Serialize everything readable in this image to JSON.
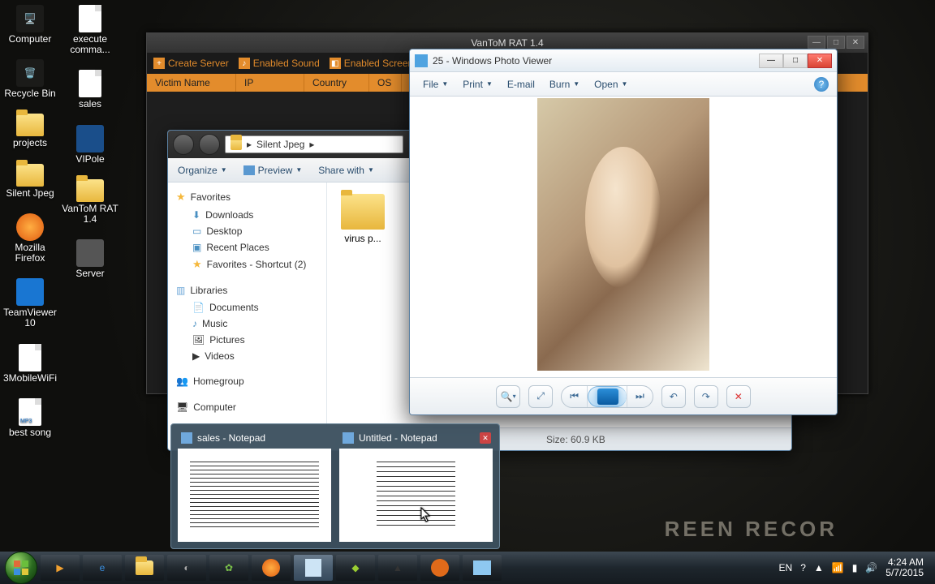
{
  "desktop": {
    "col1": [
      {
        "label": "Computer",
        "type": "monitor"
      },
      {
        "label": "Recycle Bin",
        "type": "bin"
      },
      {
        "label": "projects",
        "type": "folder"
      },
      {
        "label": "Silent Jpeg",
        "type": "folder"
      },
      {
        "label": "Mozilla Firefox",
        "type": "firefox"
      },
      {
        "label": "TeamViewer 10",
        "type": "tv"
      },
      {
        "label": "3MobileWiFi",
        "type": "3g"
      },
      {
        "label": "best song",
        "type": "mp3"
      }
    ],
    "col2": [
      {
        "label": "execute comma...",
        "type": "file"
      },
      {
        "label": "sales",
        "type": "file"
      },
      {
        "label": "VIPole",
        "type": "vip"
      },
      {
        "label": "VanToM RAT 1.4",
        "type": "folder"
      },
      {
        "label": "Server",
        "type": "server"
      }
    ]
  },
  "rat": {
    "title": "VanToM RAT 1.4",
    "toolbar": [
      {
        "label": "Create Server"
      },
      {
        "label": "Enabled Sound"
      },
      {
        "label": "Enabled ScreenShot"
      }
    ],
    "columns": [
      "Victim Name",
      "IP",
      "Country",
      "OS"
    ]
  },
  "explorer": {
    "path": "Silent Jpeg",
    "path_sep": "▸",
    "toolbar": {
      "organize": "Organize",
      "preview": "Preview",
      "share": "Share with"
    },
    "side": {
      "favorites": "Favorites",
      "fav_items": [
        "Downloads",
        "Desktop",
        "Recent Places",
        "Favorites - Shortcut (2)"
      ],
      "libraries": "Libraries",
      "lib_items": [
        "Documents",
        "Music",
        "Pictures",
        "Videos"
      ],
      "homegroup": "Homegroup",
      "computer": "Computer"
    },
    "items": [
      {
        "label": "virus p..."
      }
    ],
    "details": {
      "size_label": "Size:",
      "size": "60.9 KB"
    }
  },
  "photo": {
    "title": "25 - Windows Photo Viewer",
    "menu": [
      "File",
      "Print",
      "E-mail",
      "Burn",
      "Open"
    ]
  },
  "notepad_thumbs": [
    {
      "title": "sales - Notepad"
    },
    {
      "title": "Untitled - Notepad"
    }
  ],
  "tray": {
    "lang": "EN",
    "time": "4:24 AM",
    "date": "5/7/2015"
  },
  "watermark": "REEN RECOR"
}
